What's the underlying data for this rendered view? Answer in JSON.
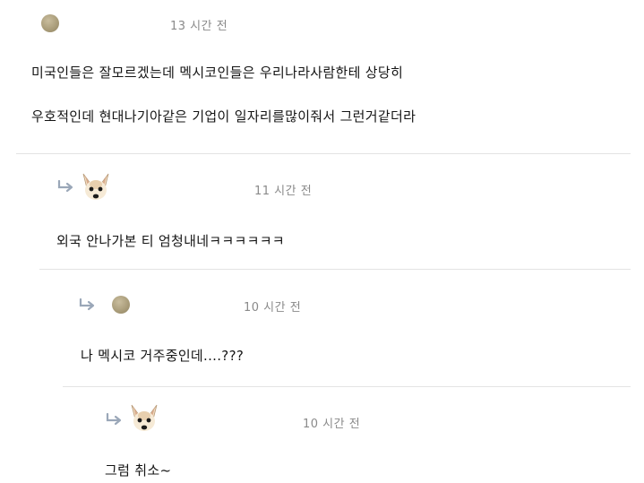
{
  "comments": [
    {
      "time": "13 시간 전",
      "lines": [
        "미국인들은 잘모르겠는데 멕시코인들은 우리나라사람한테 상당히",
        "우호적인데 현대나기아같은 기업이 일자리를많이줘서 그런거같더라"
      ]
    },
    {
      "time": "11 시간 전",
      "lines": [
        "외국 안나가본 티 엄청내네ㅋㅋㅋㅋㅋㅋ"
      ]
    },
    {
      "time": "10 시간 전",
      "lines": [
        "나 멕시코 거주중인데....???"
      ]
    },
    {
      "time": "10 시간 전",
      "lines": [
        "그럼 취소~"
      ]
    }
  ],
  "colors": {
    "reply_arrow": "#9aa7b8",
    "time_text": "#8a8a8a",
    "divider": "#e3e3e3"
  },
  "icons": {
    "reply": "reply-arrow-icon",
    "avatar_default": "avatar-dot",
    "avatar_dog": "avatar-chihuahua"
  }
}
